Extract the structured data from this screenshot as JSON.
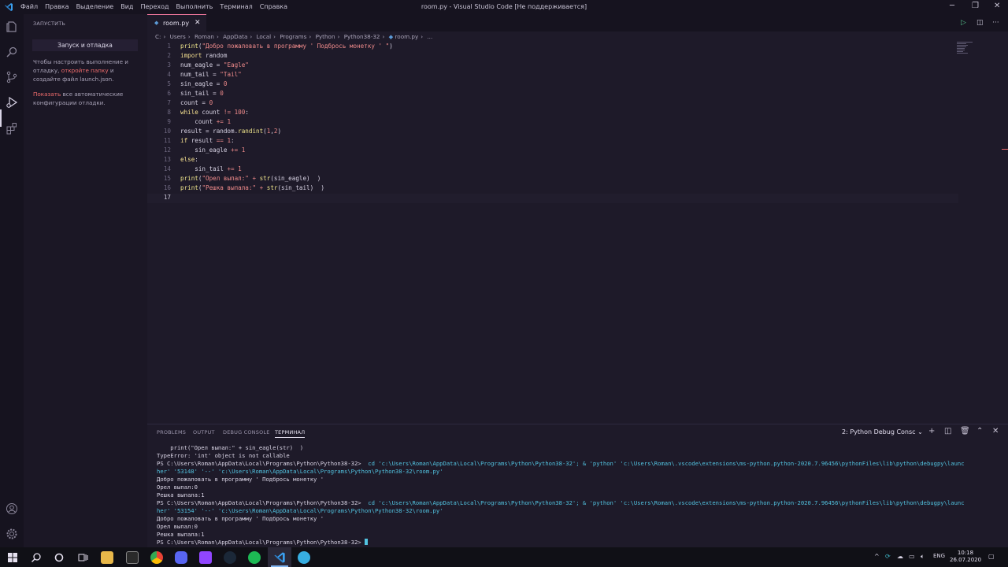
{
  "titlebar": {
    "title": "room.py - Visual Studio Code [Не поддерживается]",
    "menu": [
      "Файл",
      "Правка",
      "Выделение",
      "Вид",
      "Переход",
      "Выполнить",
      "Терминал",
      "Справка"
    ],
    "controls": {
      "minimize": "─",
      "restore": "❐",
      "close": "✕"
    }
  },
  "sidebar": {
    "title": "ЗАПУСТИТЬ",
    "run_button": "Запуск и отладка",
    "p1_pre": "Чтобы настроить выполнение и отладку,",
    "p1_link": "откройте папку",
    "p1_post": "и создайте файл launch.json.",
    "p2_link": "Показать",
    "p2_post": "все автоматические конфигурации отладки."
  },
  "tab": {
    "name": "room.py",
    "close": "✕"
  },
  "breadcrumb": [
    "C:",
    "Users",
    "Roman",
    "AppData",
    "Local",
    "Programs",
    "Python",
    "Python38-32",
    "room.py",
    "..."
  ],
  "editor": {
    "line_numbers": [
      "1",
      "2",
      "3",
      "4",
      "5",
      "6",
      "7",
      "8",
      "9",
      "10",
      "11",
      "12",
      "13",
      "14",
      "15",
      "16",
      "17"
    ]
  },
  "panel": {
    "tabs": [
      "PROBLEMS",
      "OUTPUT",
      "DEBUG CONSOLE",
      "ТЕРМИНАЛ"
    ],
    "terminal_select": "2: Python Debug Consc",
    "prompt": "PS C:\\Users\\Roman\\AppData\\Local\\Programs\\Python\\Python38-32>",
    "lines": {
      "l1": "    print(\"Орел выпал:\" + sin_eagle(str)  )",
      "l2": "TypeError: 'int' object is not callable",
      "cmd1_a": "cd 'c:\\Users\\Roman\\AppData\\Local\\Programs\\Python\\Python38-32'; & 'python' 'c:\\Users\\Roman\\.vscode\\extensions\\ms-python.python-2020.7.96456\\pythonFiles\\lib\\python\\debugpy\\launc",
      "cmd1_b": "her' '53148' '--' 'c:\\Users\\Roman\\AppData\\Local\\Programs\\Python\\Python38-32\\room.py'",
      "out1": "Добро пожаловать в программу ' Подбрось монетку '",
      "out2": "Орел выпал:0",
      "out3": "Решка выпала:1",
      "cmd2_a": "cd 'c:\\Users\\Roman\\AppData\\Local\\Programs\\Python\\Python38-32'; & 'python' 'c:\\Users\\Roman\\.vscode\\extensions\\ms-python.python-2020.7.96456\\pythonFiles\\lib\\python\\debugpy\\launc",
      "cmd2_b": "her' '53154' '--' 'c:\\Users\\Roman\\AppData\\Local\\Programs\\Python\\Python38-32\\room.py'",
      "out4": "Добро пожаловать в программу ' Подбрось монетку '",
      "out5": "Орел выпал:0",
      "out6": "Решка выпала:1"
    }
  },
  "taskbar": {
    "lang": "ENG",
    "time": "10:18",
    "date": "26.07.2020"
  }
}
